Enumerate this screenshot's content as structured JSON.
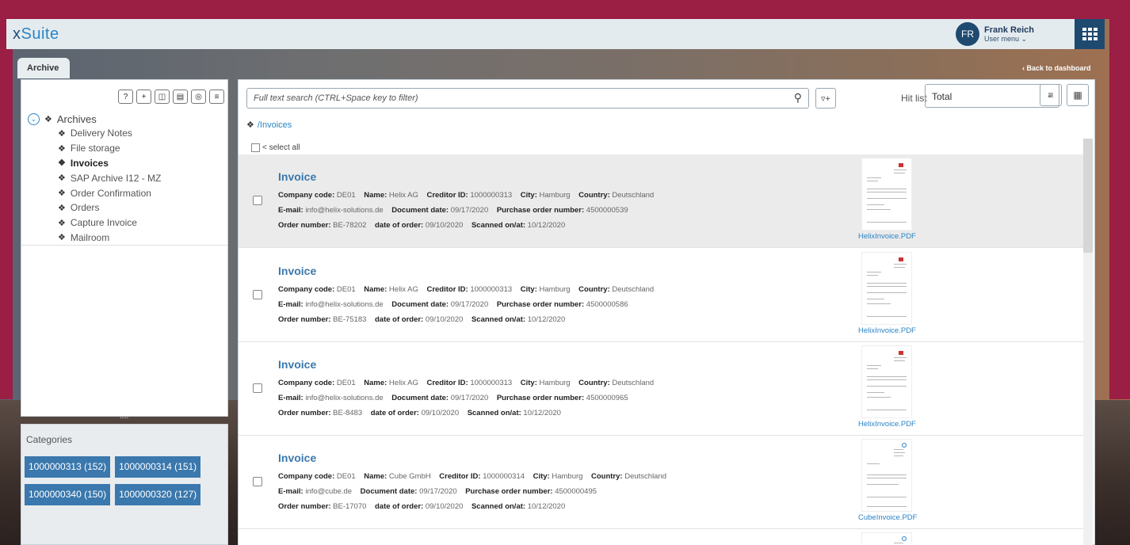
{
  "app": {
    "logo_x": "x",
    "logo_rest": "Suite"
  },
  "user": {
    "initials": "FR",
    "name": "Frank Reich",
    "menu_label": "User menu"
  },
  "tabs": {
    "archive": "Archive",
    "back": "Back to dashboard"
  },
  "tree": {
    "root": "Archives",
    "items": [
      {
        "label": "Delivery Notes"
      },
      {
        "label": "File storage"
      },
      {
        "label": "Invoices"
      },
      {
        "label": "SAP Archive I12 - MZ"
      },
      {
        "label": "Order Confirmation"
      },
      {
        "label": "Orders"
      },
      {
        "label": "Capture Invoice"
      },
      {
        "label": "Mailroom"
      }
    ],
    "active_index": 2
  },
  "categories": {
    "title": "Categories",
    "chips": [
      "1000000313 (152)",
      "1000000314 (151)",
      "1000000340 (150)",
      "1000000320 (127)"
    ]
  },
  "search": {
    "placeholder": "Full text search (CTRL+Space key to filter)"
  },
  "hitlist": {
    "label": "Hit list",
    "value": "Total"
  },
  "breadcrumb": "/Invoices",
  "select_all": "< select all",
  "results": [
    {
      "title": "Invoice",
      "company_code": "DE01",
      "name": "Helix AG",
      "creditor_id": "1000000313",
      "city": "Hamburg",
      "country": "Deutschland",
      "email": "info@helix-solutions.de",
      "document_date": "09/17/2020",
      "po_number": "4500000539",
      "order_number": "BE-78202",
      "date_of_order": "09/10/2020",
      "scanned": "10/12/2020",
      "file": "HelixInvoice.PDF"
    },
    {
      "title": "Invoice",
      "company_code": "DE01",
      "name": "Helix AG",
      "creditor_id": "1000000313",
      "city": "Hamburg",
      "country": "Deutschland",
      "email": "info@helix-solutions.de",
      "document_date": "09/17/2020",
      "po_number": "4500000586",
      "order_number": "BE-75183",
      "date_of_order": "09/10/2020",
      "scanned": "10/12/2020",
      "file": "HelixInvoice.PDF"
    },
    {
      "title": "Invoice",
      "company_code": "DE01",
      "name": "Helix AG",
      "creditor_id": "1000000313",
      "city": "Hamburg",
      "country": "Deutschland",
      "email": "info@helix-solutions.de",
      "document_date": "09/17/2020",
      "po_number": "4500000965",
      "order_number": "BE-8483",
      "date_of_order": "09/10/2020",
      "scanned": "10/12/2020",
      "file": "HelixInvoice.PDF"
    },
    {
      "title": "Invoice",
      "company_code": "DE01",
      "name": "Cube GmbH",
      "creditor_id": "1000000314",
      "city": "Hamburg",
      "country": "Deutschland",
      "email": "info@cube.de",
      "document_date": "09/17/2020",
      "po_number": "4500000495",
      "order_number": "BE-17070",
      "date_of_order": "09/10/2020",
      "scanned": "10/12/2020",
      "file": "CubeInvoice.PDF"
    }
  ],
  "field_labels": {
    "company_code": "Company code:",
    "name": "Name:",
    "creditor_id": "Creditor ID:",
    "city": "City:",
    "country": "Country:",
    "email": "E-mail:",
    "document_date": "Document date:",
    "po_number": "Purchase order number:",
    "order_number": "Order number:",
    "date_of_order": "date of order:",
    "scanned": "Scanned on/at:"
  },
  "colors": {
    "brand": "#9b1e45",
    "accent": "#3a78ad",
    "header": "#e4ebef",
    "nav": "#1f4a70"
  }
}
